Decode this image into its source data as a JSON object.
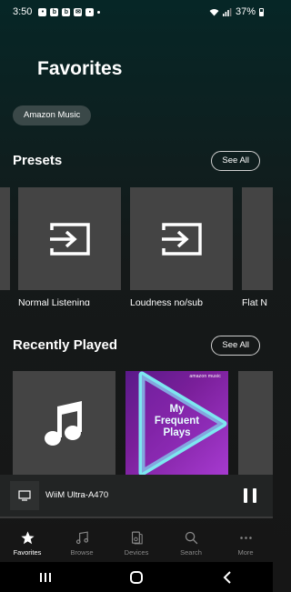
{
  "status_bar": {
    "time": "3:50",
    "battery": "37%",
    "notification_icons": [
      "message-icon",
      "b-icon",
      "b-icon",
      "mail-icon",
      "clip-icon"
    ]
  },
  "page": {
    "title": "Favorites"
  },
  "filter_chip": {
    "label": "Amazon Music"
  },
  "presets": {
    "title": "Presets",
    "see_all": "See All",
    "items": [
      {
        "label": "Normal Listening",
        "icon": "input-icon"
      },
      {
        "label": "Loudness no/sub",
        "icon": "input-icon"
      },
      {
        "label": "Flat  N",
        "icon": "input-icon"
      }
    ]
  },
  "recently_played": {
    "title": "Recently Played",
    "see_all": "See All",
    "items": [
      {
        "type": "music-note",
        "icon": "music-note-icon"
      },
      {
        "type": "playlist",
        "brand": "amazon music",
        "title_line1": "My",
        "title_line2": "Frequent",
        "title_line3": "Plays"
      },
      {
        "type": "blank"
      }
    ]
  },
  "now_playing": {
    "device_name": "WiiM Ultra-A470",
    "device_icon": "tv-icon",
    "control_icon": "pause-icon"
  },
  "tabs": [
    {
      "label": "Favorites",
      "icon": "star-icon",
      "active": true
    },
    {
      "label": "Browse",
      "icon": "music-note-icon",
      "active": false
    },
    {
      "label": "Devices",
      "icon": "speaker-icon",
      "active": false
    },
    {
      "label": "Search",
      "icon": "search-icon",
      "active": false
    },
    {
      "label": "More",
      "icon": "more-icon",
      "active": false
    }
  ],
  "colors": {
    "background_top": "#062626",
    "background_bottom": "#161616",
    "tile": "#444444",
    "chip": "#3a4848",
    "playlist_start": "#5a1a8a",
    "playlist_end": "#a63ad0"
  }
}
